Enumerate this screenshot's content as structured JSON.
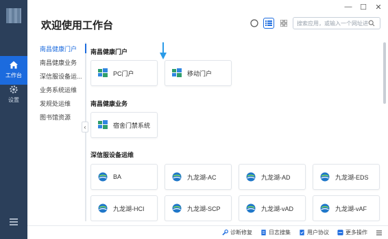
{
  "app": {
    "title": "欢迎使用工作台"
  },
  "rail": {
    "items": [
      {
        "label": "工作台",
        "active": true
      },
      {
        "label": "设置",
        "active": false
      }
    ]
  },
  "window_controls": {
    "minimize": "—",
    "maximize": "☐",
    "close": "✕"
  },
  "search": {
    "placeholder": "搜索应用，或输入一个网址进..."
  },
  "nav": {
    "items": [
      {
        "label": "南昌健康门户",
        "active": true
      },
      {
        "label": "南昌健康业务"
      },
      {
        "label": "深信服设备运..."
      },
      {
        "label": "业务系统运维"
      },
      {
        "label": "发规处运维"
      },
      {
        "label": "图书馆资源"
      }
    ]
  },
  "sections": [
    {
      "title": "南昌健康门户",
      "apps": [
        "PC门户",
        "移动门户"
      ]
    },
    {
      "title": "南昌健康业务",
      "apps": [
        "宿舍门禁系统"
      ]
    },
    {
      "title": "深信服设备运维",
      "apps": [
        "BA",
        "九龙湖-AC",
        "九龙湖-AD",
        "九龙湖-EDS",
        "九龙湖-HCI",
        "九龙湖-SCP",
        "九龙湖-vAD",
        "九龙湖-vAF"
      ]
    }
  ],
  "footer": {
    "items": [
      "诊断修复",
      "日志搜集",
      "用户协议",
      "更多操作"
    ]
  },
  "colors": {
    "accent": "#1c6bde",
    "rail": "#2b3f5a"
  }
}
